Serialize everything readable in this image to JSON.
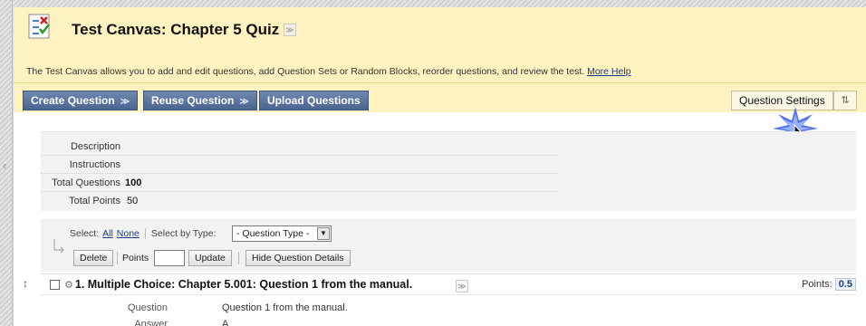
{
  "header": {
    "title": "Test Canvas: Chapter 5 Quiz",
    "description": "The Test Canvas allows you to add and edit questions, add Question Sets or Random Blocks, reorder questions, and review the test.",
    "help_link": "More Help",
    "icon": "quiz-icon"
  },
  "toolbar": {
    "create_question": "Create Question",
    "reuse_question": "Reuse Question",
    "upload_questions": "Upload Questions",
    "question_settings": "Question Settings"
  },
  "info": {
    "description_label": "Description",
    "instructions_label": "Instructions",
    "total_questions_label": "Total Questions",
    "total_questions_value": "100",
    "total_points_label": "Total Points",
    "total_points_value": "50"
  },
  "selection": {
    "select_label": "Select:",
    "all": "All",
    "none": "None",
    "select_by_type": "Select by Type:",
    "question_type": "- Question Type -",
    "delete": "Delete",
    "points_label": "Points",
    "update": "Update",
    "hide_details": "Hide Question Details"
  },
  "question": {
    "title": "1. Multiple Choice: Chapter 5.001: Question 1 from the manual.",
    "points_label": "Points:",
    "points_value": "0.5",
    "question_label": "Question",
    "question_text": "Question 1 from the manual.",
    "answer_label": "Answer",
    "answer_text": "A"
  },
  "colors": {
    "header_bg": "#fef2c0",
    "button_blue": "#5a7199",
    "link_blue": "#1a3c8c"
  }
}
